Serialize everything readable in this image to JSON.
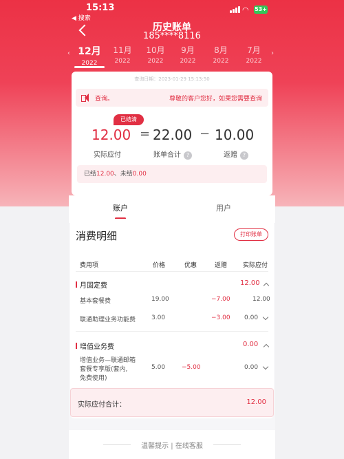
{
  "status_bar": {
    "time": "15:13",
    "back_label": "◀ 搜索",
    "battery": "53+"
  },
  "header": {
    "title": "历史账单",
    "phone": "185****8116"
  },
  "months": [
    {
      "month": "12月",
      "year": "2022",
      "active": true
    },
    {
      "month": "11月",
      "year": "2022",
      "active": false
    },
    {
      "month": "10月",
      "year": "2022",
      "active": false
    },
    {
      "month": "9月",
      "year": "2022",
      "active": false
    },
    {
      "month": "8月",
      "year": "2022",
      "active": false
    },
    {
      "month": "7月",
      "year": "2022",
      "active": false
    }
  ],
  "summary": {
    "query_date": "查询日期：2023-01-29 15:13:50",
    "notice_label": "查询。",
    "notice_text": "尊敬的客户您好，如果您需要查询",
    "badge": "已结清",
    "actual_pay": "12.00",
    "eq": "=",
    "bill_total": "22.00",
    "minus": "−",
    "rebate": "10.00",
    "actual_pay_label": "实际应付",
    "bill_total_label": "账单合计",
    "rebate_label": "返赠",
    "help_glyph": "?",
    "settled_prefix": "已结",
    "settled_value": "12.00",
    "unsettled_prefix": "、未结",
    "unsettled_value": "0.00"
  },
  "segments": {
    "account": "账户",
    "user": "用户"
  },
  "detail": {
    "title": "消费明细",
    "print_button": "打印账单",
    "columns": [
      "费用项",
      "价格",
      "优惠",
      "返赠",
      "实际应付"
    ],
    "group1": {
      "name": "月固定费",
      "total": "12.00",
      "rows": [
        {
          "item": "基本套餐费",
          "price": "19.00",
          "discount": "",
          "rebate": "−7.00",
          "pay": "12.00"
        },
        {
          "item": "联通助理业务功能费",
          "price": "3.00",
          "discount": "",
          "rebate": "−3.00",
          "pay": "0.00"
        }
      ]
    },
    "group2": {
      "name": "增值业务费",
      "total": "0.00",
      "rows": [
        {
          "item_l1": "增值业务—联通邮箱",
          "item_l2": "套餐专享版(套内,",
          "item_l3": "免费使用)",
          "price": "5.00",
          "discount": "−5.00",
          "rebate": "",
          "pay": "0.00"
        }
      ]
    },
    "total_label": "实际应付合计：",
    "total_value": "12.00"
  },
  "footer": {
    "text": "温馨提示 | 在线客服"
  },
  "colors": {
    "brand_red": "#e12f43",
    "header_red": "#ec3145",
    "pink_bg": "#fdeef0"
  }
}
